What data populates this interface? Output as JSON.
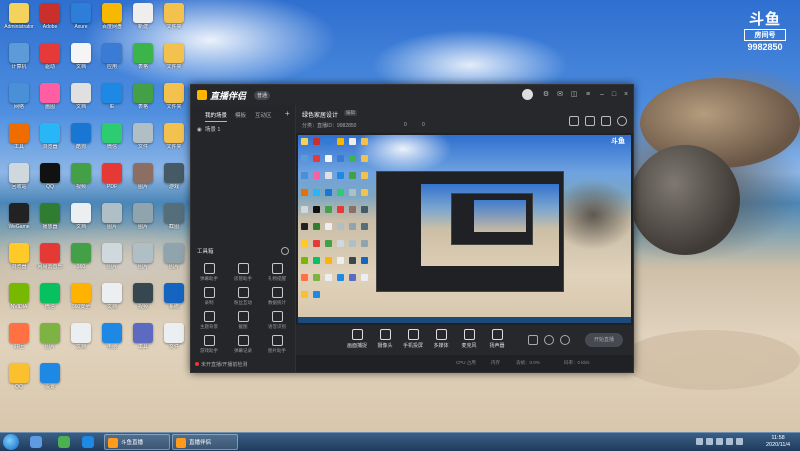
{
  "watermark": {
    "logo": "斗鱼",
    "tag": "房间号",
    "room_number": "9982850"
  },
  "desktop_icons": [
    {
      "label": "Administrator",
      "color": "#f3d35b"
    },
    {
      "label": "Adobe",
      "color": "#c9302c"
    },
    {
      "label": "Axure",
      "color": "#2d7ed8"
    },
    {
      "label": "百度网盘",
      "color": "#f6b800"
    },
    {
      "label": "新建",
      "color": "#eeeeee"
    },
    {
      "label": "文件夹",
      "color": "#f2c14e"
    },
    {
      "label": "计算机",
      "color": "#5d9bd8"
    },
    {
      "label": "驱动",
      "color": "#e63a3a"
    },
    {
      "label": "文档",
      "color": "#f5f5f5"
    },
    {
      "label": "应用",
      "color": "#3a7bd5"
    },
    {
      "label": "表格",
      "color": "#3bb54a"
    },
    {
      "label": "文件夹",
      "color": "#f2c14e"
    },
    {
      "label": "网络",
      "color": "#4a90d9"
    },
    {
      "label": "画图",
      "color": "#ff5fa2"
    },
    {
      "label": "文档",
      "color": "#e0e0e0"
    },
    {
      "label": "IE",
      "color": "#1e88e5"
    },
    {
      "label": "表格",
      "color": "#43a047"
    },
    {
      "label": "文件夹",
      "color": "#f2c14e"
    },
    {
      "label": "工具",
      "color": "#ef6c00"
    },
    {
      "label": "浏览器",
      "color": "#29b6f6"
    },
    {
      "label": "酷狗",
      "color": "#1976d2"
    },
    {
      "label": "微信",
      "color": "#2ecc71"
    },
    {
      "label": "文件",
      "color": "#b0bec5"
    },
    {
      "label": "文件夹",
      "color": "#f2c14e"
    },
    {
      "label": "回收站",
      "color": "#cfd8dc"
    },
    {
      "label": "QQ",
      "color": "#111111"
    },
    {
      "label": "视频",
      "color": "#43a047"
    },
    {
      "label": "PDF",
      "color": "#e53935"
    },
    {
      "label": "图片",
      "color": "#8d6e63"
    },
    {
      "label": "游戏",
      "color": "#455a64"
    },
    {
      "label": "WeGame",
      "color": "#222222"
    },
    {
      "label": "播放器",
      "color": "#2e7d32"
    },
    {
      "label": "文档",
      "color": "#eceff1"
    },
    {
      "label": "图片",
      "color": "#b0bec5"
    },
    {
      "label": "图片",
      "color": "#90a4ae"
    },
    {
      "label": "截图",
      "color": "#546e7a"
    },
    {
      "label": "浏览器",
      "color": "#ffca28"
    },
    {
      "label": "网易云音乐",
      "color": "#e53935"
    },
    {
      "label": "360",
      "color": "#43a047"
    },
    {
      "label": "图片",
      "color": "#cfd8dc"
    },
    {
      "label": "图片",
      "color": "#b0bec5"
    },
    {
      "label": "图片",
      "color": "#90a4ae"
    },
    {
      "label": "NVIDIA",
      "color": "#76b900"
    },
    {
      "label": "微信",
      "color": "#07c160"
    },
    {
      "label": "360安全",
      "color": "#ffb300"
    },
    {
      "label": "文档",
      "color": "#eceff1"
    },
    {
      "label": "视频",
      "color": "#37474f"
    },
    {
      "label": "系统",
      "color": "#1565c0"
    },
    {
      "label": "好压",
      "color": "#ff7043"
    },
    {
      "label": "图片",
      "color": "#7cb342"
    },
    {
      "label": "文档",
      "color": "#eceff1"
    },
    {
      "label": "电脑",
      "color": "#1e88e5"
    },
    {
      "label": "工具",
      "color": "#5c6bc0"
    },
    {
      "label": "文件",
      "color": "#eceff1"
    },
    {
      "label": "QQ",
      "color": "#fbc02d"
    },
    {
      "label": "设置",
      "color": "#1e88e5"
    }
  ],
  "app": {
    "title": "直播伴侣",
    "badge": "普通",
    "tabs": [
      "我的场景",
      "模板",
      "互动区"
    ],
    "scene": "场景 1",
    "toolbox": "工具箱",
    "tools": [
      "弹幕助手",
      "房管助手",
      "礼物提醒",
      "录制",
      "粉丝互动",
      "数据统计",
      "主题背景",
      "截图",
      "语音识别",
      "游戏助手",
      "弹幕记录",
      "图片助手"
    ],
    "live_notice": "未开直播/开播前检测",
    "room": {
      "title": "绿色家居设计",
      "edit": "编辑",
      "meta": "分类：直播ID：9982850",
      "hot": "0",
      "num": "0"
    },
    "controls": [
      "画面捕捉",
      "摄像头",
      "手机投屏",
      "多媒体",
      "麦克风",
      "扬声器"
    ],
    "start_live": "开始直播",
    "status": [
      "CPU 占用",
      "内存",
      "丢帧：0.0%",
      "码率：0 kb/s"
    ]
  },
  "taskbar": {
    "tasks": [
      "斗鱼直播",
      "直播伴侣"
    ],
    "time": "11:58",
    "date": "2020/11/4"
  }
}
